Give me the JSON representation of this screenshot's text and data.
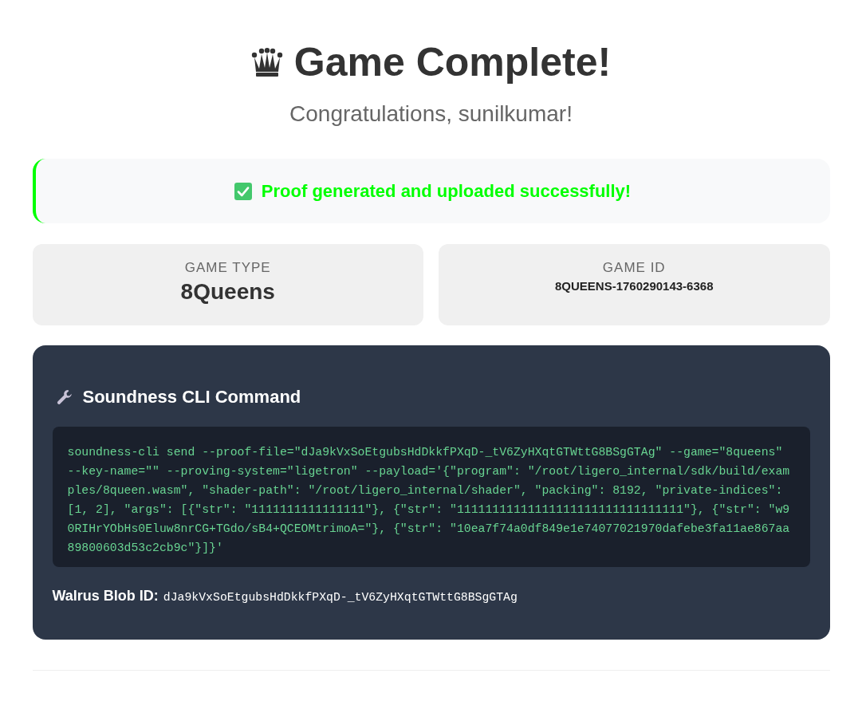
{
  "header": {
    "title": "Game Complete!",
    "subtitle": "Congratulations, sunilkumar!"
  },
  "status": {
    "kind": "success",
    "message": "Proof generated and uploaded successfully!"
  },
  "info_cards": [
    {
      "kind": "large",
      "label": "GAME TYPE",
      "value": "8Queens"
    },
    {
      "kind": "small",
      "label": "GAME ID",
      "value": "8QUEENS-1760290143-6368"
    }
  ],
  "command": {
    "title": "Soundness CLI Command",
    "code": "soundness-cli send --proof-file=\"dJa9kVxSoEtgubsHdDkkfPXqD-_tV6ZyHXqtGTWttG8BSgGTAg\" --game=\"8queens\" --key-name=\"\" --proving-system=\"ligetron\" --payload='{\"program\": \"/root/ligero_internal/sdk/build/examples/8queen.wasm\", \"shader-path\": \"/root/ligero_internal/shader\", \"packing\": 8192, \"private-indices\": [1, 2], \"args\": [{\"str\": \"1111111111111111\"}, {\"str\": \"11111111111111111111111111111111\"}, {\"str\": \"w90RIHrYObHs0Eluw8nrCG+TGdo/sB4+QCEOMtrimoA=\"}, {\"str\": \"10ea7f74a0df849e1e74077021970dafebe3fa11ae867aa89800603d53c2cb9c\"}]}'",
    "blob_label": "Walrus Blob ID:",
    "blob_id": "dJa9kVxSoEtgubsHdDkkfPXqD-_tV6ZyHXqtGTWttG8BSgGTAg"
  }
}
